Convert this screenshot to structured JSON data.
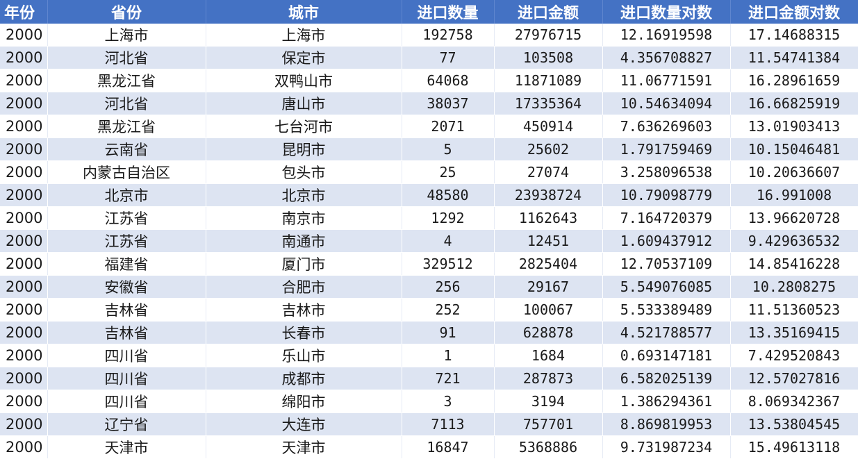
{
  "columns": [
    "年份",
    "省份",
    "城市",
    "进口数量",
    "进口金额",
    "进口数量对数",
    "进口金额对数"
  ],
  "rows": [
    [
      "2000",
      "上海市",
      "上海市",
      "192758",
      "27976715",
      "12.16919598",
      "17.14688315"
    ],
    [
      "2000",
      "河北省",
      "保定市",
      "77",
      "103508",
      "4.356708827",
      "11.54741384"
    ],
    [
      "2000",
      "黑龙江省",
      "双鸭山市",
      "64068",
      "11871089",
      "11.06771591",
      "16.28961659"
    ],
    [
      "2000",
      "河北省",
      "唐山市",
      "38037",
      "17335364",
      "10.54634094",
      "16.66825919"
    ],
    [
      "2000",
      "黑龙江省",
      "七台河市",
      "2071",
      "450914",
      "7.636269603",
      "13.01903413"
    ],
    [
      "2000",
      "云南省",
      "昆明市",
      "5",
      "25602",
      "1.791759469",
      "10.15046481"
    ],
    [
      "2000",
      "内蒙古自治区",
      "包头市",
      "25",
      "27074",
      "3.258096538",
      "10.20636607"
    ],
    [
      "2000",
      "北京市",
      "北京市",
      "48580",
      "23938724",
      "10.79098779",
      "16.991008"
    ],
    [
      "2000",
      "江苏省",
      "南京市",
      "1292",
      "1162643",
      "7.164720379",
      "13.96620728"
    ],
    [
      "2000",
      "江苏省",
      "南通市",
      "4",
      "12451",
      "1.609437912",
      "9.429636532"
    ],
    [
      "2000",
      "福建省",
      "厦门市",
      "329512",
      "2825404",
      "12.70537109",
      "14.85416228"
    ],
    [
      "2000",
      "安徽省",
      "合肥市",
      "256",
      "29167",
      "5.549076085",
      "10.2808275"
    ],
    [
      "2000",
      "吉林省",
      "吉林市",
      "252",
      "100067",
      "5.533389489",
      "11.51360523"
    ],
    [
      "2000",
      "吉林省",
      "长春市",
      "91",
      "628878",
      "4.521788577",
      "13.35169415"
    ],
    [
      "2000",
      "四川省",
      "乐山市",
      "1",
      "1684",
      "0.693147181",
      "7.429520843"
    ],
    [
      "2000",
      "四川省",
      "成都市",
      "721",
      "287873",
      "6.582025139",
      "12.57027816"
    ],
    [
      "2000",
      "四川省",
      "绵阳市",
      "3",
      "3194",
      "1.386294361",
      "8.069342367"
    ],
    [
      "2000",
      "辽宁省",
      "大连市",
      "7113",
      "757701",
      "8.869819953",
      "13.53804545"
    ],
    [
      "2000",
      "天津市",
      "天津市",
      "16847",
      "5368886",
      "9.731987234",
      "15.49613118"
    ]
  ],
  "colors": {
    "header_bg": "#4472c4",
    "header_text": "#ffffff",
    "band": "#dde4f2"
  }
}
